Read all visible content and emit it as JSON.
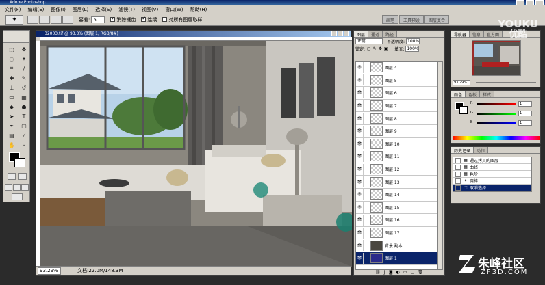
{
  "app": {
    "title": "Adobe Photoshop"
  },
  "menu": [
    "文件(F)",
    "编辑(E)",
    "图像(I)",
    "图层(L)",
    "选择(S)",
    "滤镜(T)",
    "视图(V)",
    "窗口(W)",
    "帮助(H)"
  ],
  "options": {
    "tolerance_label": "容差:",
    "tolerance_value": "5",
    "antialias_label": "消除锯齿",
    "contiguous_label": "连续",
    "all_layers_label": "对所有图层取样"
  },
  "palette_well": [
    "画笔",
    "工具预设",
    "图层复合"
  ],
  "document": {
    "title": "32003.tif @ 93.3% (图层 1, RGB/8#)",
    "zoom": "93.29%",
    "doc_info": "文档:22.0M/148.3M"
  },
  "layers_palette": {
    "tabs": [
      "图层",
      "通道",
      "路径"
    ],
    "blend_mode": "正常",
    "opacity_label": "不透明度:",
    "opacity_value": "100%",
    "lock_label": "锁定:",
    "fill_label": "填充:",
    "fill_value": "100%",
    "layers": [
      {
        "name": "图层 4",
        "selected": false,
        "bg": false
      },
      {
        "name": "图层 5",
        "selected": false,
        "bg": false
      },
      {
        "name": "图层 6",
        "selected": false,
        "bg": false
      },
      {
        "name": "图层 7",
        "selected": false,
        "bg": false
      },
      {
        "name": "图层 8",
        "selected": false,
        "bg": false
      },
      {
        "name": "图层 9",
        "selected": false,
        "bg": false
      },
      {
        "name": "图层 10",
        "selected": false,
        "bg": false
      },
      {
        "name": "图层 11",
        "selected": false,
        "bg": false
      },
      {
        "name": "图层 12",
        "selected": false,
        "bg": false
      },
      {
        "name": "图层 13",
        "selected": false,
        "bg": false
      },
      {
        "name": "图层 14",
        "selected": false,
        "bg": false
      },
      {
        "name": "图层 15",
        "selected": false,
        "bg": false
      },
      {
        "name": "图层 16",
        "selected": false,
        "bg": false
      },
      {
        "name": "图层 17",
        "selected": false,
        "bg": false
      },
      {
        "name": "背景 副本",
        "selected": false,
        "bg": true
      },
      {
        "name": "图层 1",
        "selected": true,
        "bg": false
      }
    ]
  },
  "navigator": {
    "tabs": [
      "导航器",
      "信息",
      "直方图"
    ],
    "zoom": "93.29%"
  },
  "color_palette": {
    "tabs": [
      "颜色",
      "色板",
      "样式"
    ],
    "channels": [
      {
        "label": "R",
        "value": "1"
      },
      {
        "label": "G",
        "value": "1"
      },
      {
        "label": "B",
        "value": "1"
      }
    ]
  },
  "history_palette": {
    "tabs": [
      "历史记录",
      "动作"
    ],
    "items": [
      {
        "label": "通过拷贝的图层",
        "icon": "▦",
        "selected": false
      },
      {
        "label": "曲线",
        "icon": "▦",
        "selected": false
      },
      {
        "label": "色阶",
        "icon": "▦",
        "selected": false
      },
      {
        "label": "魔棒",
        "icon": "✦",
        "selected": false
      },
      {
        "label": "取消选择",
        "icon": "⬚",
        "selected": true
      }
    ]
  },
  "watermarks": {
    "youku_line1": "YOUKU",
    "youku_line2": "优酷",
    "site_name": "朱峰社区",
    "site_url": "ZF3D.COM"
  },
  "colors": {
    "selection_highlight": "#0a246a",
    "ui_face": "#d4d0c8"
  }
}
